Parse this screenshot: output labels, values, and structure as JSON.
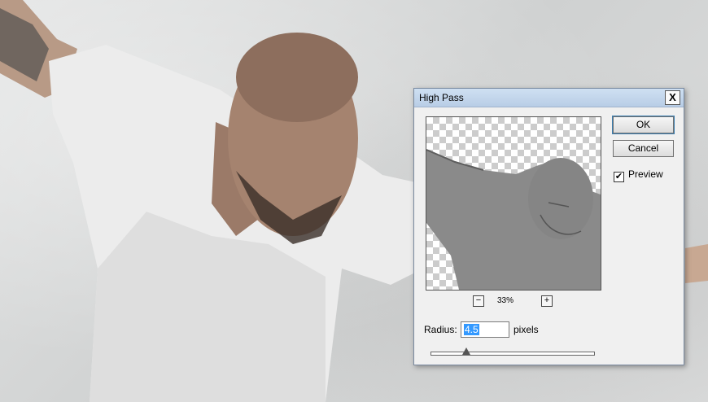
{
  "dialog": {
    "title": "High Pass",
    "close_label": "X",
    "ok_label": "OK",
    "cancel_label": "Cancel",
    "preview_label": "Preview",
    "preview_checked": true,
    "checkmark": "✔",
    "zoom_minus": "−",
    "zoom_plus": "+",
    "zoom_percent": "33%",
    "radius_label": "Radius:",
    "radius_value": "4.5",
    "radius_unit": "pixels",
    "slider_level": 0.22
  },
  "colors": {
    "titlebar": "#bcd0e8",
    "selection": "#3399ff",
    "preview_gray": "#8a8a8a"
  }
}
